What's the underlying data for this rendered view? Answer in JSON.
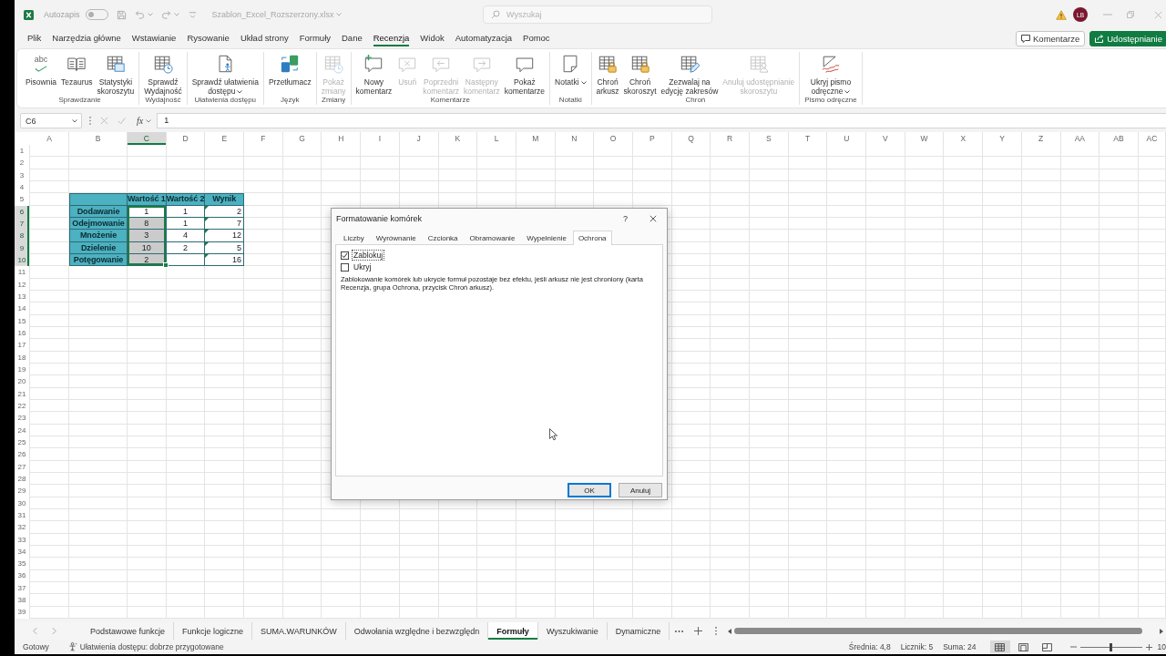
{
  "title_bar": {
    "autosave": {
      "label": "Autozapis",
      "on": false
    },
    "filename": "Szablon_Excel_Rozszerzony.xlsx",
    "search": {
      "placeholder": "Wyszukaj"
    },
    "avatar": "LB"
  },
  "menu": [
    {
      "label": "Plik",
      "selected": false
    },
    {
      "label": "Narzędzia główne",
      "selected": false
    },
    {
      "label": "Wstawianie",
      "selected": false
    },
    {
      "label": "Rysowanie",
      "selected": false
    },
    {
      "label": "Układ strony",
      "selected": false
    },
    {
      "label": "Formuły",
      "selected": false
    },
    {
      "label": "Dane",
      "selected": false
    },
    {
      "label": "Recenzja",
      "selected": true
    },
    {
      "label": "Widok",
      "selected": false
    },
    {
      "label": "Automatyzacja",
      "selected": false
    },
    {
      "label": "Pomoc",
      "selected": false
    }
  ],
  "actions": [
    {
      "label": "Komentarze",
      "kind": "outline"
    },
    {
      "label": "Udostępnianie",
      "kind": "primary"
    }
  ],
  "ribbon": [
    {
      "label": "Sprawdzanie",
      "commands": [
        {
          "label": "Pisownia",
          "glyph": "abc",
          "disabled": false,
          "dropdown": false
        },
        {
          "label": "Tezaurus",
          "disabled": false,
          "dropdown": false
        },
        {
          "label": "Statystyki\nskoroszytu",
          "disabled": false,
          "dropdown": false
        }
      ]
    },
    {
      "label": "Wydajność",
      "commands": [
        {
          "label": "Sprawdź\nWydajność",
          "disabled": false,
          "dropdown": false
        }
      ]
    },
    {
      "label": "Ułatwienia dostępu",
      "commands": [
        {
          "label": "Sprawdź ułatwienia\ndostępu",
          "disabled": false,
          "dropdown": true
        }
      ]
    },
    {
      "label": "Język",
      "commands": [
        {
          "label": "Przetłumacz",
          "disabled": false,
          "dropdown": false
        }
      ]
    },
    {
      "label": "Zmiany",
      "commands": [
        {
          "label": "Pokaż\nzmiany",
          "disabled": true,
          "dropdown": false
        }
      ]
    },
    {
      "label": "Komentarze",
      "commands": [
        {
          "label": "Nowy\nkomentarz",
          "disabled": false,
          "dropdown": false
        },
        {
          "label": "Usuń",
          "disabled": true,
          "dropdown": false
        },
        {
          "label": "Poprzedni\nkomentarz",
          "disabled": true,
          "dropdown": false
        },
        {
          "label": "Następny\nkomentarz",
          "disabled": true,
          "dropdown": false
        },
        {
          "label": "Pokaż\nkomentarze",
          "disabled": false,
          "dropdown": false
        }
      ]
    },
    {
      "label": "Notatki",
      "commands": [
        {
          "label": "Notatki",
          "disabled": false,
          "dropdown": true
        }
      ]
    },
    {
      "label": "Chroń",
      "commands": [
        {
          "label": "Chroń\narkusz",
          "disabled": false,
          "dropdown": false
        },
        {
          "label": "Chroń\nskoroszyt",
          "disabled": false,
          "dropdown": false
        },
        {
          "label": "Zezwalaj na\nedycję zakresów",
          "disabled": false,
          "dropdown": false
        },
        {
          "label": "Anuluj udostępnianie\nskoroszytu",
          "disabled": true,
          "dropdown": false
        }
      ]
    },
    {
      "label": "Pismo odręczne",
      "commands": [
        {
          "label": "Ukryj pismo\nodręczne",
          "disabled": false,
          "dropdown": true
        }
      ]
    }
  ],
  "formula_bar": {
    "name_box": "C6",
    "function_label": "fx",
    "formula": "1"
  },
  "sheet": {
    "columns": [
      {
        "label": "A",
        "selected": false
      },
      {
        "label": "B",
        "selected": false
      },
      {
        "label": "C",
        "selected": true
      },
      {
        "label": "D",
        "selected": false
      },
      {
        "label": "E",
        "selected": false
      },
      {
        "label": "F",
        "selected": false
      },
      {
        "label": "G",
        "selected": false
      },
      {
        "label": "H",
        "selected": false
      },
      {
        "label": "I",
        "selected": false
      },
      {
        "label": "J",
        "selected": false
      },
      {
        "label": "K",
        "selected": false
      },
      {
        "label": "L",
        "selected": false
      },
      {
        "label": "M",
        "selected": false
      },
      {
        "label": "N",
        "selected": false
      },
      {
        "label": "O",
        "selected": false
      },
      {
        "label": "P",
        "selected": false
      },
      {
        "label": "Q",
        "selected": false
      },
      {
        "label": "R",
        "selected": false
      },
      {
        "label": "S",
        "selected": false
      },
      {
        "label": "T",
        "selected": false
      },
      {
        "label": "U",
        "selected": false
      },
      {
        "label": "V",
        "selected": false
      },
      {
        "label": "W",
        "selected": false
      },
      {
        "label": "X",
        "selected": false
      },
      {
        "label": "Y",
        "selected": false
      },
      {
        "label": "Z",
        "selected": false
      },
      {
        "label": "AA",
        "selected": false
      },
      {
        "label": "AB",
        "selected": false
      },
      {
        "label": "AC",
        "selected": false
      }
    ],
    "rows": [
      {
        "label": "1",
        "selected": false
      },
      {
        "label": "2",
        "selected": false
      },
      {
        "label": "3",
        "selected": false
      },
      {
        "label": "4",
        "selected": false
      },
      {
        "label": "5",
        "selected": false
      },
      {
        "label": "6",
        "selected": true
      },
      {
        "label": "7",
        "selected": true
      },
      {
        "label": "8",
        "selected": true
      },
      {
        "label": "9",
        "selected": true
      },
      {
        "label": "10",
        "selected": true
      },
      {
        "label": "11",
        "selected": false
      },
      {
        "label": "12",
        "selected": false
      },
      {
        "label": "13",
        "selected": false
      },
      {
        "label": "14",
        "selected": false
      },
      {
        "label": "15",
        "selected": false
      },
      {
        "label": "16",
        "selected": false
      },
      {
        "label": "17",
        "selected": false
      },
      {
        "label": "18",
        "selected": false
      },
      {
        "label": "19",
        "selected": false
      },
      {
        "label": "20",
        "selected": false
      },
      {
        "label": "21",
        "selected": false
      },
      {
        "label": "22",
        "selected": false
      },
      {
        "label": "23",
        "selected": false
      },
      {
        "label": "24",
        "selected": false
      },
      {
        "label": "25",
        "selected": false
      },
      {
        "label": "26",
        "selected": false
      },
      {
        "label": "27",
        "selected": false
      },
      {
        "label": "28",
        "selected": false
      },
      {
        "label": "29",
        "selected": false
      },
      {
        "label": "30",
        "selected": false
      },
      {
        "label": "31",
        "selected": false
      },
      {
        "label": "32",
        "selected": false
      },
      {
        "label": "33",
        "selected": false
      },
      {
        "label": "34",
        "selected": false
      },
      {
        "label": "35",
        "selected": false
      },
      {
        "label": "36",
        "selected": false
      },
      {
        "label": "37",
        "selected": false
      },
      {
        "label": "38",
        "selected": false
      },
      {
        "label": "39",
        "selected": false
      }
    ],
    "table": {
      "header": [
        "Wartość 1",
        "Wartość 2",
        "Wynik"
      ],
      "rows": [
        {
          "label": "Dodawanie",
          "cells": [
            {
              "value": "1",
              "highlighted": false,
              "flagged": false
            },
            {
              "value": "1",
              "highlighted": false,
              "flagged": false
            },
            {
              "value": "2",
              "highlighted": false,
              "flagged": true
            }
          ]
        },
        {
          "label": "Odejmowanie",
          "cells": [
            {
              "value": "8",
              "highlighted": true,
              "flagged": false
            },
            {
              "value": "1",
              "highlighted": false,
              "flagged": false
            },
            {
              "value": "7",
              "highlighted": false,
              "flagged": true
            }
          ]
        },
        {
          "label": "Mnożenie",
          "cells": [
            {
              "value": "3",
              "highlighted": true,
              "flagged": false
            },
            {
              "value": "4",
              "highlighted": false,
              "flagged": false
            },
            {
              "value": "12",
              "highlighted": false,
              "flagged": true
            }
          ]
        },
        {
          "label": "Dzielenie",
          "cells": [
            {
              "value": "10",
              "highlighted": true,
              "flagged": false
            },
            {
              "value": "2",
              "highlighted": false,
              "flagged": false
            },
            {
              "value": "5",
              "highlighted": false,
              "flagged": true
            }
          ]
        },
        {
          "label": "Potęgowanie",
          "cells": [
            {
              "value": "2",
              "highlighted": true,
              "flagged": false
            },
            {
              "highlighted": false,
              "flagged": false
            },
            {
              "value": "16",
              "highlighted": false,
              "flagged": true
            }
          ]
        }
      ]
    }
  },
  "dialog": {
    "title": "Formatowanie komórek",
    "help": "?",
    "tabs": [
      {
        "label": "Liczby",
        "selected": false
      },
      {
        "label": "Wyrównanie",
        "selected": false
      },
      {
        "label": "Czcionka",
        "selected": false
      },
      {
        "label": "Obramowanie",
        "selected": false
      },
      {
        "label": "Wypełnienie",
        "selected": false
      },
      {
        "label": "Ochrona",
        "selected": true
      }
    ],
    "options": [
      {
        "label": "Zablokuj",
        "checked": true,
        "focused": true
      },
      {
        "label": "Ukryj",
        "checked": false,
        "focused": false
      }
    ],
    "note": "Zablokowanie komórek lub ukrycie formuł pozostaje bez efektu, jeśli arkusz nie jest chroniony (karta Recenzja, grupa Ochrona, przycisk Chroń arkusz).",
    "buttons": [
      {
        "label": "OK",
        "default": true
      },
      {
        "label": "Anuluj",
        "default": false
      }
    ]
  },
  "sheet_tabs": [
    {
      "label": "Podstawowe funkcje",
      "selected": false
    },
    {
      "label": "Funkcje logiczne",
      "selected": false
    },
    {
      "label": "SUMA.WARUNKÓW",
      "selected": false
    },
    {
      "label": "Odwołania względne i bezwzględn",
      "selected": false
    },
    {
      "label": "Formuły",
      "selected": true
    },
    {
      "label": "Wyszukiwanie",
      "selected": false
    },
    {
      "label": "Dynamiczne",
      "selected": false
    }
  ],
  "status_bar": {
    "mode": "Gotowy",
    "accessibility": "Ułatwienia dostępu: dobrze przygotowane",
    "stats": [
      "Średnia: 4,8",
      "Licznik: 5",
      "Suma: 24"
    ],
    "views": [
      {
        "selected": true
      },
      {
        "selected": false
      },
      {
        "selected": false
      }
    ],
    "zoom": {
      "level": 0.5,
      "label": "10"
    }
  }
}
